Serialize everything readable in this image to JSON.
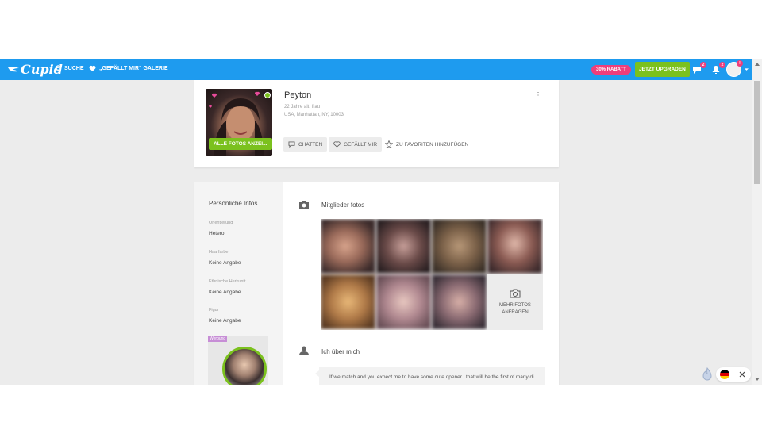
{
  "navbar": {
    "logo": "Cupid",
    "search_label": "SUCHE",
    "gallery_label": "„GEFÄLLT MIR“ GALERIE",
    "discount_label": "30% RABATT",
    "upgrade_label": "JETZT UPGRADEN",
    "messages_count": "2",
    "notifications_count": "2",
    "profile_alert": "!",
    "accent_color": "#1e9bef"
  },
  "profile": {
    "name": "Peyton",
    "age_gender": "22 Jahre alt, frau",
    "location": "USA, Manhattan, NY, 10003",
    "show_photos_label": "ALLE FOTOS ANZEI...",
    "chat_label": "CHATTEN",
    "like_label": "GEFÄLLT MIR",
    "favorite_label": "ZU FAVORITEN HINZUFÜGEN",
    "online": true
  },
  "personal_info": {
    "title": "Persönliche Infos",
    "fields": [
      {
        "label": "Orientierung",
        "value": "Hetero"
      },
      {
        "label": "Haarfarbe",
        "value": "Keine Angabe"
      },
      {
        "label": "Ethnische Herkunft",
        "value": "Keine Angabe"
      },
      {
        "label": "Figur",
        "value": "Keine Angabe"
      }
    ],
    "ad_tag": "Werbung"
  },
  "photos": {
    "title": "Mitglieder fotos",
    "more_label_line1": "MEHR FOTOS",
    "more_label_line2": "ANFRAGEN"
  },
  "about": {
    "title": "Ich über mich",
    "text": "If we match and you expect me to have some cute opener...that will be the first of many di"
  },
  "colors": {
    "green": "#7bc11e",
    "pink": "#ef3e7b",
    "background": "#ececec"
  }
}
